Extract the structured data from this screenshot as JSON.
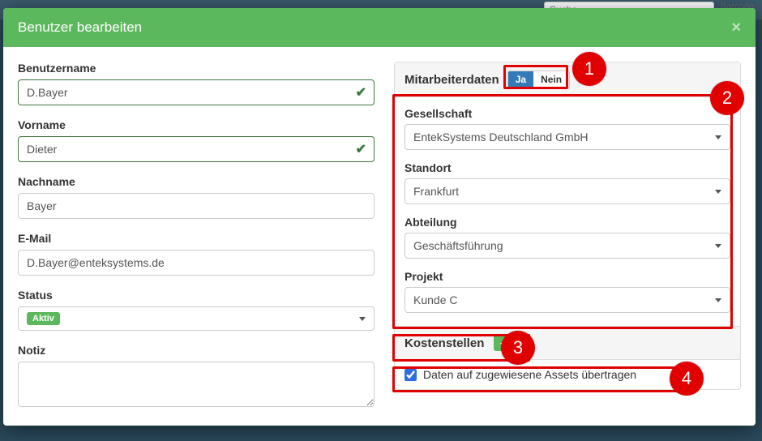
{
  "bg": {
    "search_placeholder": "Suche...",
    "barcode_label": "Barcode"
  },
  "modal": {
    "title": "Benutzer bearbeiten"
  },
  "left": {
    "username_label": "Benutzername",
    "username_value": "D.Bayer",
    "firstname_label": "Vorname",
    "firstname_value": "Dieter",
    "lastname_label": "Nachname",
    "lastname_value": "Bayer",
    "email_label": "E-Mail",
    "email_value": "D.Bayer@enteksystems.de",
    "status_label": "Status",
    "status_value": "Aktiv",
    "note_label": "Notiz",
    "note_value": ""
  },
  "right": {
    "employee_heading": "Mitarbeiterdaten",
    "toggle_yes": "Ja",
    "toggle_no": "Nein",
    "company_label": "Gesellschaft",
    "company_value": "EntekSystems Deutschland GmbH",
    "location_label": "Standort",
    "location_value": "Frankfurt",
    "department_label": "Abteilung",
    "department_value": "Geschäftsführung",
    "project_label": "Projekt",
    "project_value": "Kunde C",
    "costcenter_label": "Kostenstellen",
    "transfer_label": "Daten auf zugewiesene Assets übertragen",
    "transfer_checked": true
  },
  "annotations": {
    "n1": "1",
    "n2": "2",
    "n3": "3",
    "n4": "4"
  }
}
